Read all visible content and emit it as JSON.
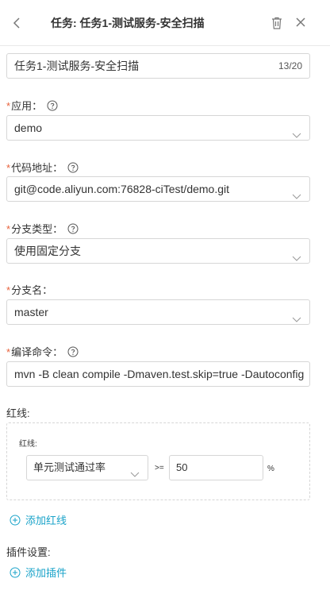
{
  "header": {
    "title": "任务: 任务1-测试服务-安全扫描"
  },
  "task_name": {
    "value": "任务1-测试服务-安全扫描",
    "counter": "13/20"
  },
  "fields": {
    "app": {
      "label": "应用：",
      "value": "demo"
    },
    "repo": {
      "label": "代码地址：",
      "value": "git@code.aliyun.com:76828-ciTest/demo.git"
    },
    "branch_type": {
      "label": "分支类型：",
      "value": "使用固定分支"
    },
    "branch_name": {
      "label": "分支名：",
      "value": "master"
    },
    "build_cmd": {
      "label": "编译命令：",
      "value": "mvn -B clean compile -Dmaven.test.skip=true -Dautoconfig"
    }
  },
  "required_mark": "*",
  "redline": {
    "section_label": "红线:",
    "item_label": "红线:",
    "metric": "单元测试通过率",
    "operator": ">=",
    "threshold": "50",
    "unit": "%",
    "add_label": "添加红线"
  },
  "plugins": {
    "section_label": "插件设置:",
    "add_label": "添加插件"
  },
  "colors": {
    "required": "#e8623c",
    "link": "#1aa3c9",
    "border": "#d6d6d6"
  },
  "icons": {
    "back": "chevron-left-icon",
    "delete": "trash-icon",
    "close": "close-icon",
    "help": "question-circle-icon",
    "dropdown": "chevron-down-icon",
    "add": "plus-circle-icon"
  }
}
